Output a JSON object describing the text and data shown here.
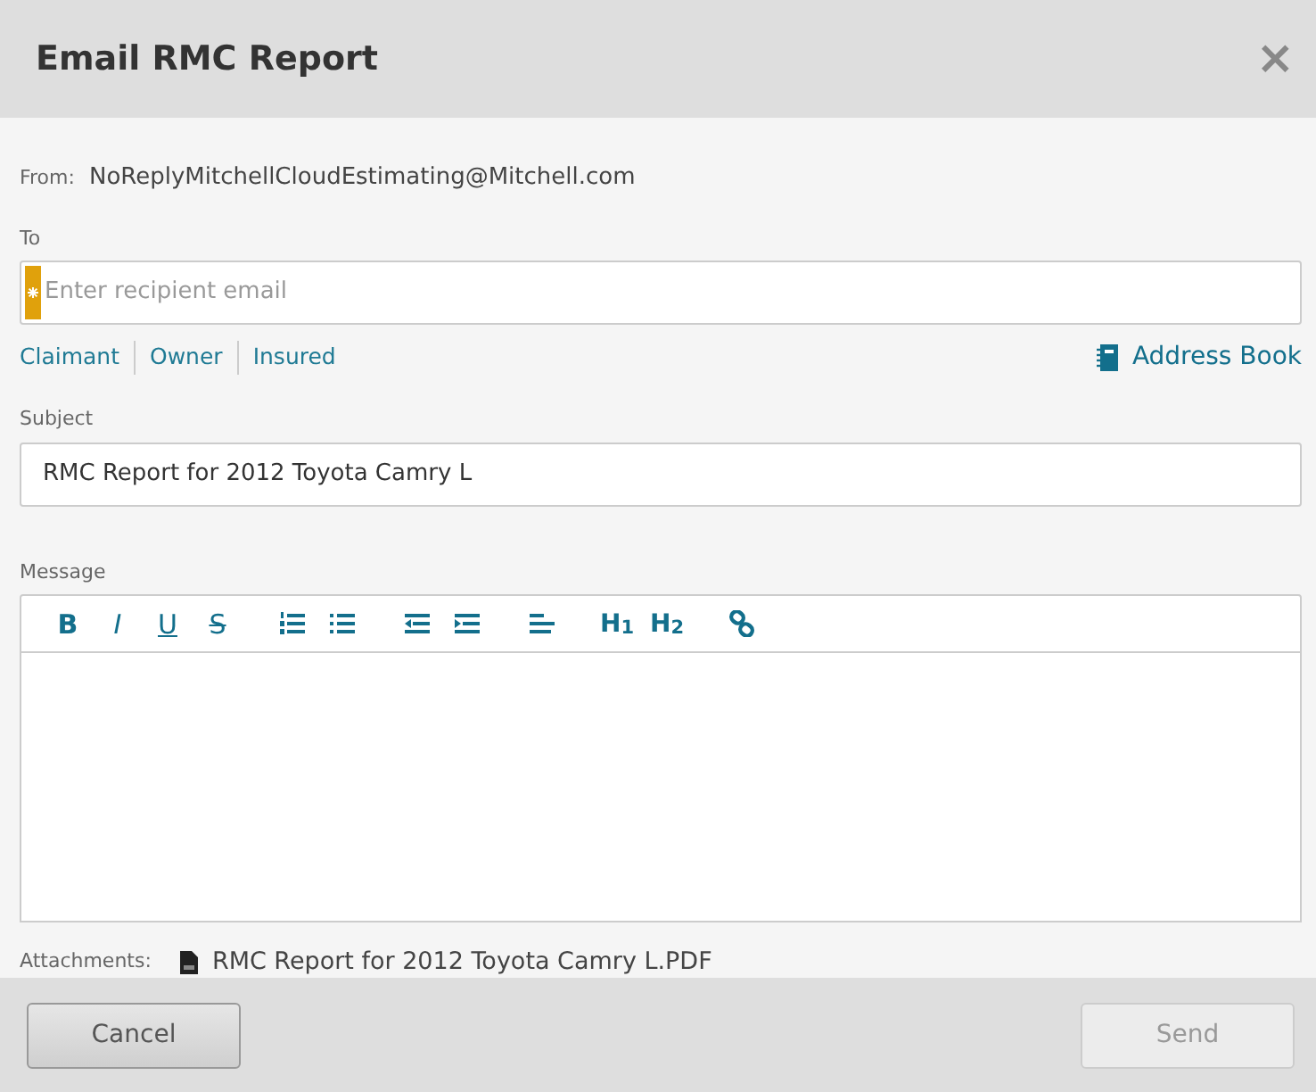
{
  "dialog": {
    "title": "Email RMC Report",
    "close": "×"
  },
  "from": {
    "label": "From:",
    "value": "NoReplyMitchellCloudEstimating@Mitchell.com"
  },
  "to": {
    "label": "To",
    "placeholder": "Enter recipient email",
    "required": true
  },
  "recipient_links": [
    "Claimant",
    "Owner",
    "Insured"
  ],
  "address_book": "Address Book",
  "subject": {
    "label": "Subject",
    "value": "RMC Report for 2012 Toyota Camry L"
  },
  "message": {
    "label": "Message"
  },
  "toolbar": [
    {
      "kind": "bold",
      "label": "B"
    },
    {
      "kind": "italic",
      "label": "I"
    },
    {
      "kind": "underline",
      "label": "U"
    },
    {
      "kind": "strike",
      "label": "S"
    },
    {
      "kind": "numbered"
    },
    {
      "kind": "bulleted"
    },
    {
      "kind": "outdent"
    },
    {
      "kind": "indent"
    },
    {
      "kind": "align"
    },
    {
      "kind": "heading",
      "label": "H$_{1}$"
    },
    {
      "kind": "heading",
      "label": "H$_{2}$"
    },
    {
      "kind": "link"
    }
  ],
  "attachments": {
    "label": "Attachments:",
    "files": [
      "RMC Report for 2012 Toyota Camry L.PDF"
    ]
  },
  "buttons": [
    {
      "label": "Cancel",
      "disabled": false
    },
    {
      "label": "Send",
      "disabled": true
    }
  ]
}
